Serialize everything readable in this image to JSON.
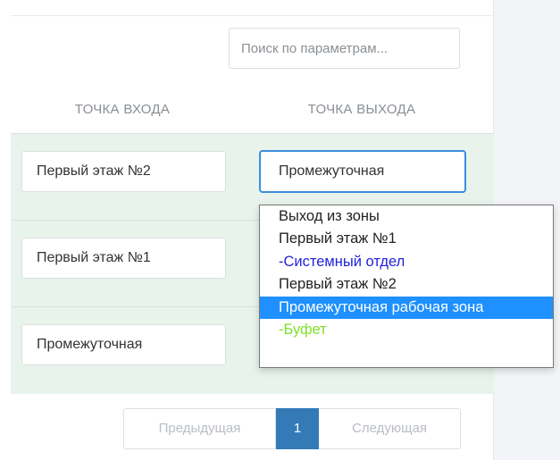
{
  "search": {
    "placeholder": "Поиск по параметрам..."
  },
  "table": {
    "columns": [
      "ТОЧКА ВХОДА",
      "ТОЧКА ВЫХОДА"
    ],
    "rows": [
      {
        "entry": "Первый этаж №2",
        "exit": "Промежуточная"
      },
      {
        "entry": "Первый этаж №1",
        "exit": ""
      },
      {
        "entry": "Промежуточная",
        "exit": ""
      }
    ]
  },
  "dropdown": {
    "options": [
      {
        "label": "Выход из зоны",
        "color": "#222222"
      },
      {
        "label": "Первый этаж №1",
        "color": "#222222"
      },
      {
        "label": "-Системный отдел",
        "color": "#2222dd"
      },
      {
        "label": "Первый этаж №2",
        "color": "#222222"
      },
      {
        "label": "Промежуточная рабочая зона",
        "color": "#ffffff",
        "selected": true
      },
      {
        "label": "-Буфет",
        "color": "#7ee02a"
      }
    ]
  },
  "pagination": {
    "prev": "Предыдущая",
    "current": "1",
    "next": "Следующая"
  },
  "colors": {
    "row_background": "#e8f3ec",
    "focus_border": "#3c8ddc",
    "selected_option": "#1e90ff",
    "current_page": "#337ab7"
  }
}
